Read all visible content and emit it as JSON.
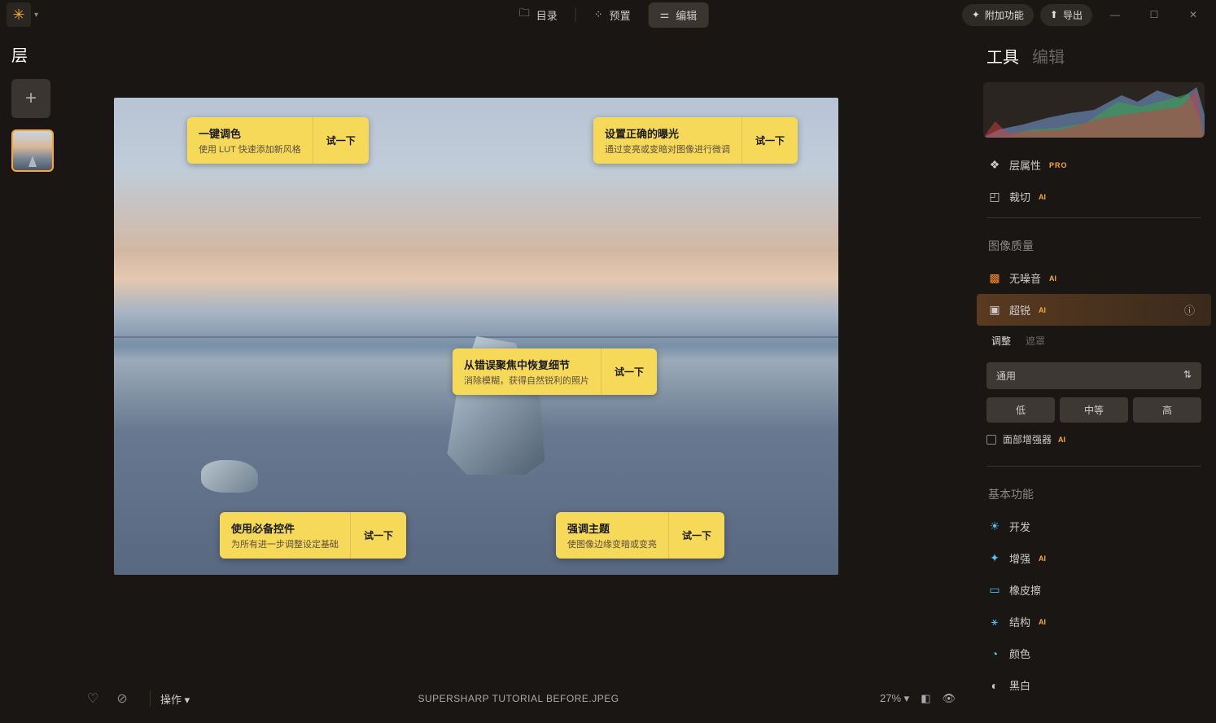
{
  "topbar": {
    "tabs": {
      "catalog": "目录",
      "presets": "预置",
      "edit": "编辑"
    },
    "extras": "附加功能",
    "export": "导出"
  },
  "left": {
    "title": "层"
  },
  "tips": {
    "t1": {
      "title": "一键调色",
      "desc": "使用 LUT 快速添加新风格",
      "btn": "试一下"
    },
    "t2": {
      "title": "设置正确的曝光",
      "desc": "通过变亮或变暗对图像进行微调",
      "btn": "试一下"
    },
    "t3": {
      "title": "从错误聚焦中恢复细节",
      "desc": "消除模糊，获得自然锐利的照片",
      "btn": "试一下"
    },
    "t4": {
      "title": "使用必备控件",
      "desc": "为所有进一步调整设定基础",
      "btn": "试一下"
    },
    "t5": {
      "title": "强调主题",
      "desc": "使图像边缘变暗或变亮",
      "btn": "试一下"
    }
  },
  "bottom": {
    "ops": "操作",
    "filename": "SUPERSHARP TUTORIAL BEFORE.JPEG",
    "zoom": "27%"
  },
  "right": {
    "tabs": {
      "tools": "工具",
      "edit": "编辑"
    },
    "layerprops": "层属性",
    "pro": "PRO",
    "ai": "AI",
    "crop": "裁切",
    "section_quality": "图像质量",
    "noiseless": "无噪音",
    "supersharp": "超锐",
    "subtabs": {
      "adjust": "调整",
      "mask": "遮罩"
    },
    "select_option": "通用",
    "seg": {
      "low": "低",
      "mid": "中等",
      "high": "高"
    },
    "face_enhance": "面部增强器",
    "section_basic": "基本功能",
    "basic": {
      "develop": "开发",
      "enhance": "增强",
      "eraser": "橡皮擦",
      "structure": "结构",
      "color": "颜色",
      "bw": "黑白"
    }
  }
}
